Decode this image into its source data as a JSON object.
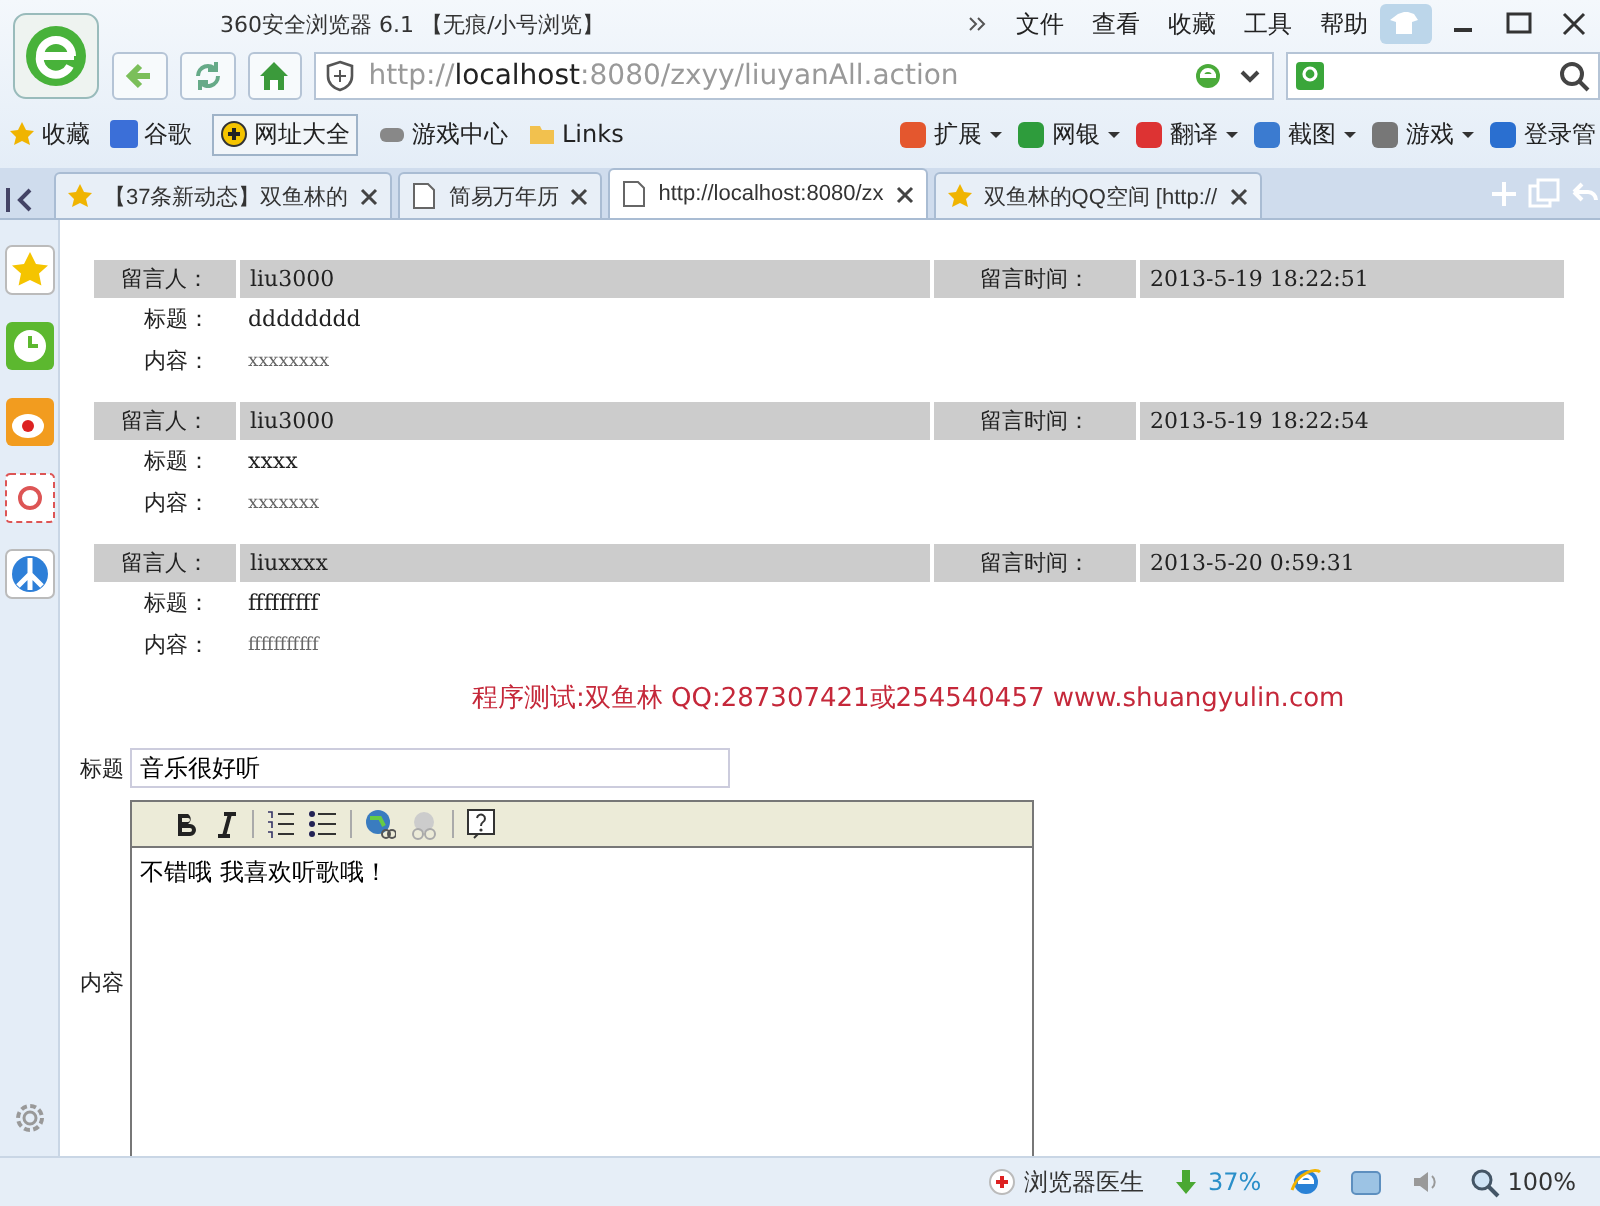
{
  "window": {
    "title": "360安全浏览器 6.1 【无痕/小号浏览】"
  },
  "menu": [
    "文件",
    "查看",
    "收藏",
    "工具",
    "帮助"
  ],
  "address_bar": {
    "scheme": "http://",
    "host": "localhost",
    "path": ":8080/zxyy/liuyanAll.action"
  },
  "bookmarks": [
    "收藏",
    "谷歌",
    "网址大全",
    "游戏中心",
    "Links"
  ],
  "tools": [
    "扩展",
    "网银",
    "翻译",
    "截图",
    "游戏",
    "登录管"
  ],
  "tabs": [
    {
      "label": "【37条新动态】双鱼林的",
      "selected": false
    },
    {
      "label": "简易万年历",
      "selected": false
    },
    {
      "label": "http://localhost:8080/zx",
      "selected": true
    },
    {
      "label": "双鱼林的QQ空间 [http://",
      "selected": false
    }
  ],
  "messages": [
    {
      "author_label": "留言人：",
      "author": "liu3000",
      "time_label": "留言时间：",
      "time": "2013-5-19 18:22:51",
      "title_label": "标题：",
      "title": "dddddddd",
      "content_label": "内容：",
      "content": "xxxxxxxx"
    },
    {
      "author_label": "留言人：",
      "author": "liu3000",
      "time_label": "留言时间：",
      "time": "2013-5-19 18:22:54",
      "title_label": "标题：",
      "title": "xxxx",
      "content_label": "内容：",
      "content": "xxxxxxx"
    },
    {
      "author_label": "留言人：",
      "author": "liuxxxx",
      "time_label": "留言时间：",
      "time": "2013-5-20 0:59:31",
      "title_label": "标题：",
      "title": "fffffffff",
      "content_label": "内容：",
      "content": "fffffffffff"
    }
  ],
  "notice": "程序测试:双鱼林 QQ:287307421或254540457 www.shuangyulin.com",
  "form": {
    "title_label": "标题",
    "title_value": "音乐很好听",
    "content_label": "内容",
    "content_value": "不错哦 我喜欢听歌哦！"
  },
  "status_bar": {
    "doctor": "浏览器医生",
    "download": "37%",
    "zoom": "100%"
  }
}
